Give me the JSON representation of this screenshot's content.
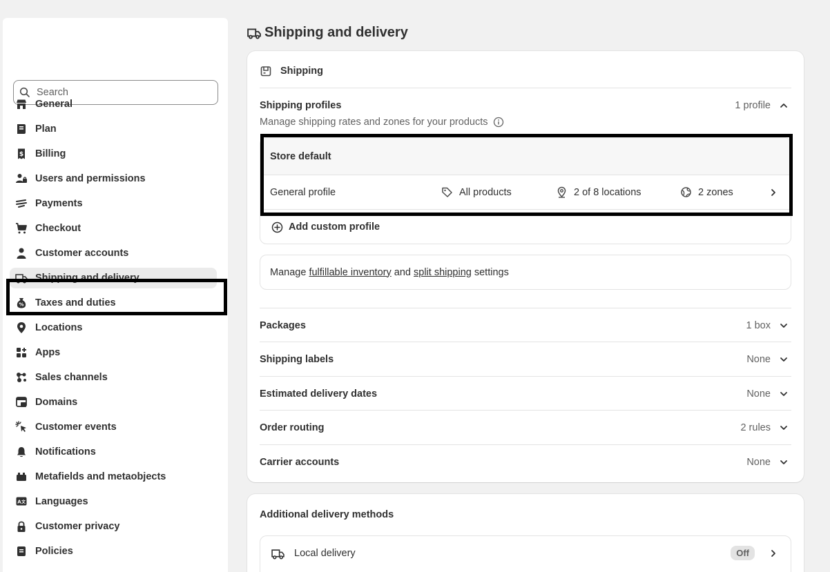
{
  "sidebar": {
    "search_placeholder": "Search",
    "items": [
      {
        "label": "General",
        "icon": "store-icon"
      },
      {
        "label": "Plan",
        "icon": "plan-icon"
      },
      {
        "label": "Billing",
        "icon": "receipt-icon"
      },
      {
        "label": "Users and permissions",
        "icon": "users-icon"
      },
      {
        "label": "Payments",
        "icon": "payments-icon"
      },
      {
        "label": "Checkout",
        "icon": "cart-icon"
      },
      {
        "label": "Customer accounts",
        "icon": "person-icon"
      },
      {
        "label": "Shipping and delivery",
        "icon": "truck-icon",
        "active": true
      },
      {
        "label": "Taxes and duties",
        "icon": "tax-icon"
      },
      {
        "label": "Locations",
        "icon": "location-icon"
      },
      {
        "label": "Apps",
        "icon": "apps-icon"
      },
      {
        "label": "Sales channels",
        "icon": "channels-icon"
      },
      {
        "label": "Domains",
        "icon": "domains-icon"
      },
      {
        "label": "Customer events",
        "icon": "cursor-icon"
      },
      {
        "label": "Notifications",
        "icon": "bell-icon"
      },
      {
        "label": "Metafields and metaobjects",
        "icon": "metafields-icon"
      },
      {
        "label": "Languages",
        "icon": "language-icon"
      },
      {
        "label": "Customer privacy",
        "icon": "lock-icon"
      },
      {
        "label": "Policies",
        "icon": "policies-icon"
      }
    ]
  },
  "page": {
    "title": "Shipping and delivery"
  },
  "shipping_card": {
    "header": "Shipping",
    "profiles": {
      "title": "Shipping profiles",
      "count": "1 profile",
      "description": "Manage shipping rates and zones for your products"
    },
    "store_default": {
      "title": "Store default",
      "profile_name": "General profile",
      "products": "All products",
      "locations": "2 of 8 locations",
      "zones": "2 zones"
    },
    "add_custom_profile": "Add custom profile",
    "manage": {
      "prefix": "Manage",
      "link1": "fulfillable inventory",
      "middle": "and",
      "link2": "split shipping",
      "suffix": "settings"
    },
    "rows": [
      {
        "title": "Packages",
        "value": "1 box"
      },
      {
        "title": "Shipping labels",
        "value": "None"
      },
      {
        "title": "Estimated delivery dates",
        "value": "None"
      },
      {
        "title": "Order routing",
        "value": "2 rules"
      },
      {
        "title": "Carrier accounts",
        "value": "None"
      }
    ]
  },
  "delivery_card": {
    "header": "Additional delivery methods",
    "local_delivery": {
      "label": "Local delivery",
      "status": "Off"
    }
  }
}
